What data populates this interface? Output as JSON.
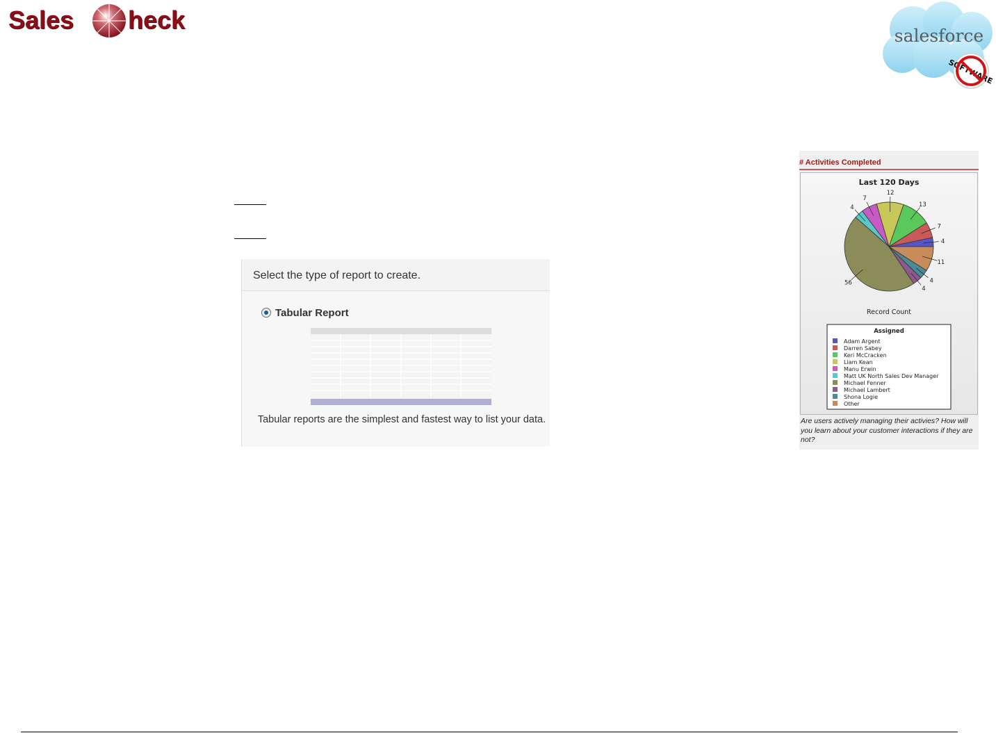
{
  "header": {
    "logo_text_left": "Sales",
    "logo_text_right": "heck",
    "partner_logo_text": "salesforce",
    "partner_badge_text": "SOFTWARE"
  },
  "report_type": {
    "prompt": "Select the type of report to create.",
    "option_label": "Tabular Report",
    "selected": true,
    "description": "Tabular reports are the simplest and fastest way to list your data."
  },
  "activities_panel": {
    "heading": "# Activities Completed",
    "caption": "Are users actively managing their activies? How will you learn about your customer interactions if they are not?"
  },
  "chart_data": {
    "type": "pie",
    "title": "Last 120 Days",
    "xlabel": "Record Count",
    "legend_title": "Assigned",
    "legend_position": "bottom",
    "categories": [
      "Adam Argent",
      "Darren Sabey",
      "Keri McCracken",
      "Liam Kean",
      "Manu Erwin",
      "Matt UK North Sales Dev Manager",
      "Michael Fenner",
      "Michael Lambert",
      "Shona Logie",
      "Other"
    ],
    "values": [
      4,
      7,
      13,
      12,
      7,
      4,
      56,
      4,
      4,
      11
    ],
    "colors": [
      "#5656c8",
      "#c85a5a",
      "#5ac85a",
      "#c8c85a",
      "#c85ac8",
      "#5ac8c8",
      "#8c8c5a",
      "#8c5a8c",
      "#4a8c96",
      "#c88c5a"
    ]
  }
}
